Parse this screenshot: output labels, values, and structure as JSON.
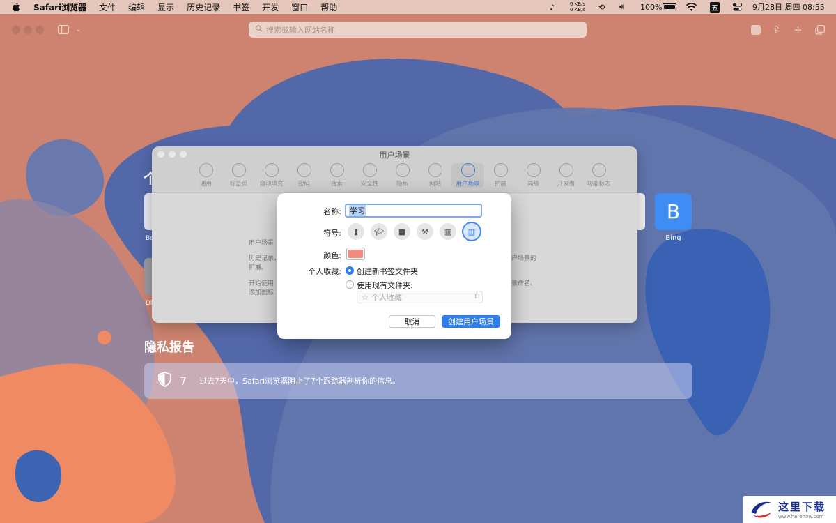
{
  "menubar": {
    "app_name": "Safari浏览器",
    "items": [
      "文件",
      "编辑",
      "显示",
      "历史记录",
      "书签",
      "开发",
      "窗口",
      "帮助"
    ],
    "net_up": "0 KB/s",
    "net_down": "0 KB/s",
    "battery": "100%",
    "input_method": "五",
    "datetime": "9月28日 周四  08:55"
  },
  "toolbar": {
    "search_placeholder": "搜索或输入网站名称"
  },
  "prefs_window": {
    "title": "用户场景",
    "tabs": [
      {
        "label": "通用",
        "icon": "gear-icon"
      },
      {
        "label": "标签页",
        "icon": "tabs-icon"
      },
      {
        "label": "自动填充",
        "icon": "pencil-field-icon"
      },
      {
        "label": "密码",
        "icon": "key-icon"
      },
      {
        "label": "搜索",
        "icon": "magnifier-icon"
      },
      {
        "label": "安全性",
        "icon": "lock-icon"
      },
      {
        "label": "隐私",
        "icon": "hand-icon"
      },
      {
        "label": "网站",
        "icon": "globe-icon"
      },
      {
        "label": "用户场景",
        "icon": "person-icon"
      },
      {
        "label": "扩展",
        "icon": "puzzle-icon"
      },
      {
        "label": "高级",
        "icon": "gears-icon"
      },
      {
        "label": "开发者",
        "icon": "tools-icon"
      },
      {
        "label": "功能标志",
        "icon": "flags-icon"
      }
    ],
    "selected_tab": "用户场景",
    "body_fragments": [
      "用户场景",
      "历史记录，",
      "扩展。",
      "开始使用",
      "添加图标",
      "户场景的",
      "景命名、"
    ]
  },
  "dialog": {
    "name_label": "名称:",
    "name_value": "学习",
    "symbol_label": "符号:",
    "symbols": [
      "id-badge-icon",
      "graduation-cap-icon",
      "briefcase-icon",
      "hammer-icon",
      "building-icon",
      "books-icon"
    ],
    "selected_symbol": "books-icon",
    "color_label": "颜色:",
    "color_value": "#f18d7e",
    "favorites_label": "个人收藏:",
    "option_new": "创建新书签文件夹",
    "option_existing": "使用现有文件夹:",
    "selected_option": "创建新书签文件夹",
    "folder_select": "个人收藏",
    "cancel": "取消",
    "create": "创建用户场景"
  },
  "startpage": {
    "tile_bing_letter": "B",
    "tile_bing_label": "Bing",
    "partial_labels": [
      "个",
      "Bo",
      "Di"
    ],
    "privacy_title": "隐私报告",
    "privacy_count": "7",
    "privacy_text": "过去7天中，Safari浏览器阻止了7个跟踪器剖析你的信息。"
  },
  "watermark": {
    "brand": "这里下载",
    "url": "www.herehow.com"
  },
  "colors": {
    "accent": "#2f7de9",
    "background": "#cd8370",
    "blue_shape": "#3a66b4"
  }
}
